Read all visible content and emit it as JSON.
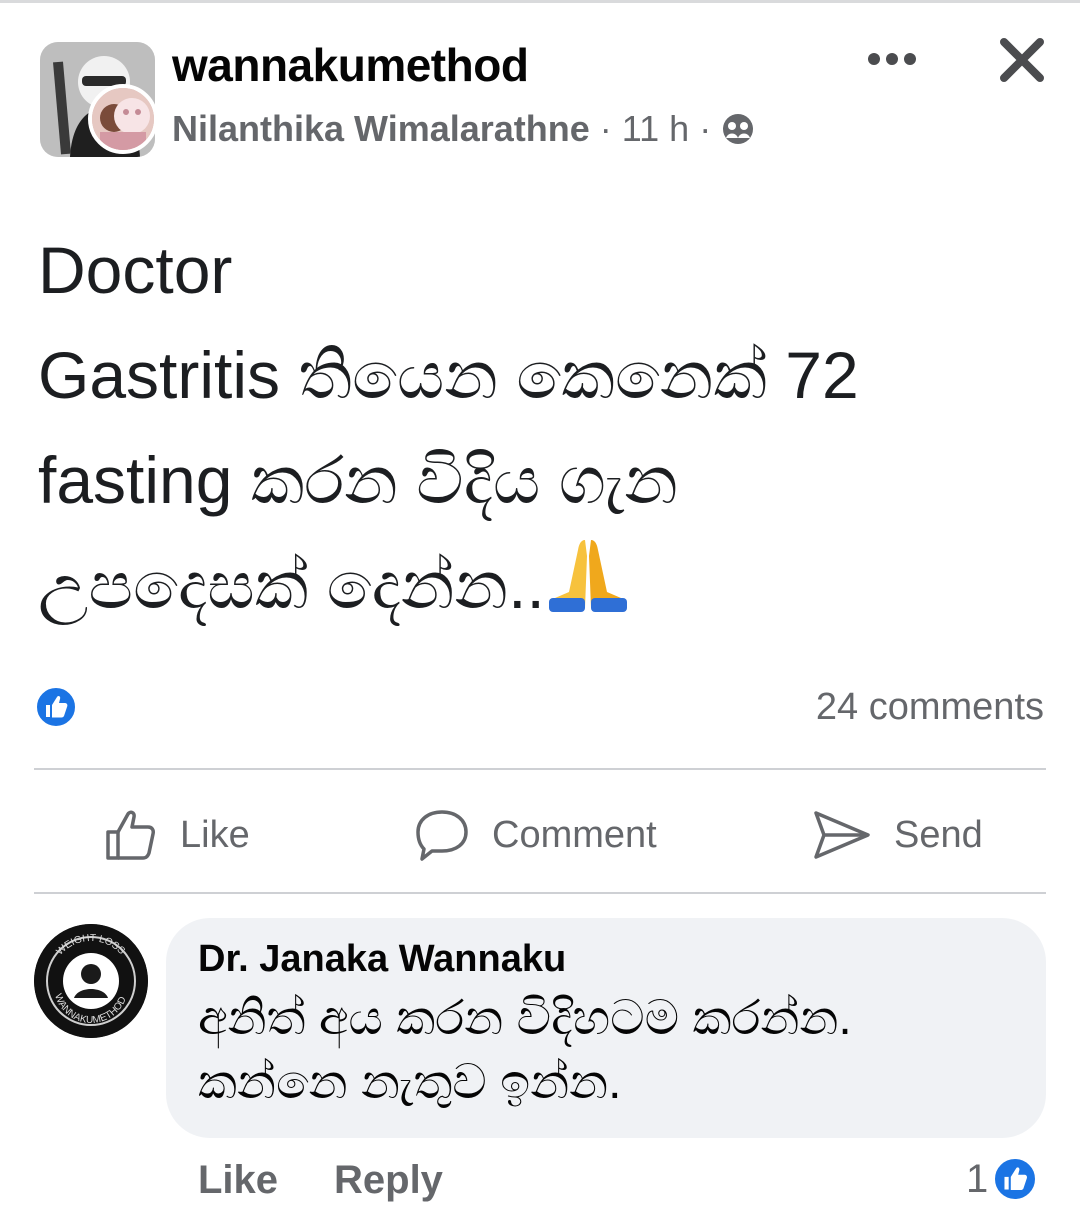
{
  "post": {
    "group_name": "wannakumethod",
    "author": "Nilanthika Wimalarathne",
    "time": "11 h",
    "separator": "·",
    "text_lines": [
      "Doctor",
      "Gastritis තියෙන කෙනෙක් 72",
      "fasting කරන විදිය ගැන",
      "උපදෙසක් දෙන්න.."
    ],
    "emoji": "folded-hands-icon",
    "comments_count": "24 comments"
  },
  "actions": {
    "like": "Like",
    "comment": "Comment",
    "send": "Send"
  },
  "comment": {
    "name": "Dr. Janaka Wannaku",
    "text_lines": [
      "අනිත් අය කරන විදිහටම කරන්න.",
      "කන්නෙ නැතුව ඉන්න."
    ],
    "like_label": "Like",
    "reply_label": "Reply",
    "like_count": "1",
    "avatar_ring_text_top": "WEIGHT LOSS",
    "avatar_ring_text_bottom": "WANNAKUMETHOD"
  },
  "colors": {
    "facebook_blue": "#1b74e4",
    "secondary_text": "#65676b",
    "bubble_bg": "#f0f2f5"
  }
}
